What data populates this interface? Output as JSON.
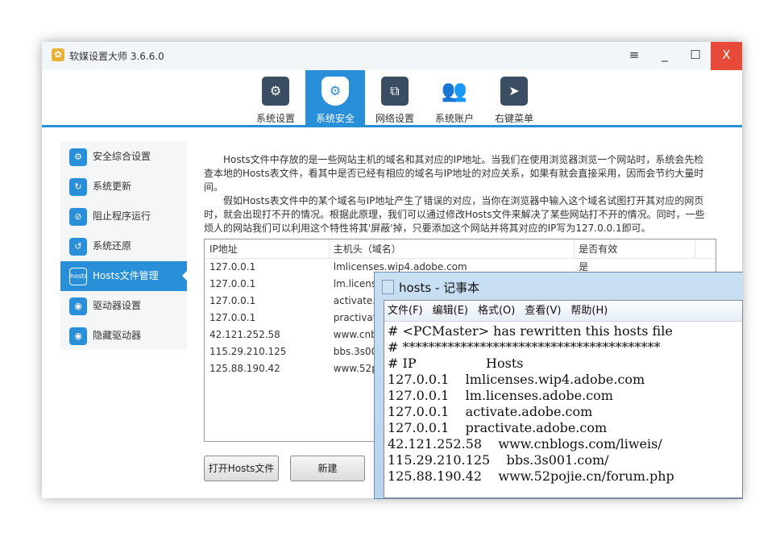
{
  "window": {
    "title": "软媒设置大师 3.6.6.0",
    "menu_icon": "≡",
    "minimize": "_",
    "maximize": "☐",
    "close": "X"
  },
  "toolbar": [
    {
      "label": "系统设置",
      "icon": "gear-screen-icon"
    },
    {
      "label": "系统安全",
      "icon": "shield-icon"
    },
    {
      "label": "网络设置",
      "icon": "network-icon"
    },
    {
      "label": "系统账户",
      "icon": "users-icon"
    },
    {
      "label": "右键菜单",
      "icon": "cursor-menu-icon"
    }
  ],
  "sidebar": [
    {
      "label": "安全综合设置",
      "icon": "shield-icon"
    },
    {
      "label": "系统更新",
      "icon": "refresh-icon"
    },
    {
      "label": "阻止程序运行",
      "icon": "block-window-icon"
    },
    {
      "label": "系统还原",
      "icon": "restore-icon"
    },
    {
      "label": "Hosts文件管理",
      "icon": "hosts-icon"
    },
    {
      "label": "驱动器设置",
      "icon": "drive-icon"
    },
    {
      "label": "隐藏驱动器",
      "icon": "hide-drive-icon"
    }
  ],
  "description": [
    "Hosts文件中存放的是一些网站主机的域名和其对应的IP地址。当我们在使用浏览器浏览一个网站时，系统会先检查本地的Hosts表文件，看其中是否已经有相应的域名与IP地址的对应关系，如果有就会直接采用，因而会节约大量时间。",
    "假如Hosts表文件中的某个域名与IP地址产生了错误的对应，当你在浏览器中输入这个域名试图打开其对应的网页时，就会出现打不开的情况。根据此原理，我们可以通过修改Hosts文件来解决了某些网站打不开的情况。同时，一些烦人的网站我们可以利用这个特性将其'屏蔽'掉，只要添加这个网站并将其对应的IP写为127.0.0.1即可。"
  ],
  "table": {
    "headers": [
      "IP地址",
      "主机头（域名）",
      "是否有效"
    ],
    "rows": [
      [
        "127.0.0.1",
        "lmlicenses.wip4.adobe.com",
        "是"
      ],
      [
        "127.0.0.1",
        "lm.licenses.adobe.com",
        ""
      ],
      [
        "127.0.0.1",
        "activate.adobe.com",
        ""
      ],
      [
        "127.0.0.1",
        "practivate.adobe.com",
        ""
      ],
      [
        "42.121.252.58",
        "www.cnblogs.com/liweis/",
        ""
      ],
      [
        "115.29.210.125",
        "bbs.3s001.com/",
        ""
      ],
      [
        "125.88.190.42",
        "www.52pojie.cn/forum.php",
        ""
      ]
    ]
  },
  "buttons": {
    "open_hosts": "打开Hosts文件",
    "new": "新建"
  },
  "notepad": {
    "title": "hosts - 记事本",
    "menu": [
      "文件(F)",
      "编辑(E)",
      "格式(O)",
      "查看(V)",
      "帮助(H)"
    ],
    "lines": [
      "# <PCMaster> has rewritten this hosts file",
      "# ****************************************",
      "# IP                 Hosts",
      "127.0.0.1    lmlicenses.wip4.adobe.com",
      "127.0.0.1    lm.licenses.adobe.com",
      "127.0.0.1    activate.adobe.com",
      "127.0.0.1    practivate.adobe.com",
      "42.121.252.58    www.cnblogs.com/liweis/",
      "115.29.210.125    bbs.3s001.com/",
      "125.88.190.42    www.52pojie.cn/forum.php"
    ]
  },
  "colors": {
    "accent": "#2a8fd9",
    "close": "#e84a3a"
  }
}
